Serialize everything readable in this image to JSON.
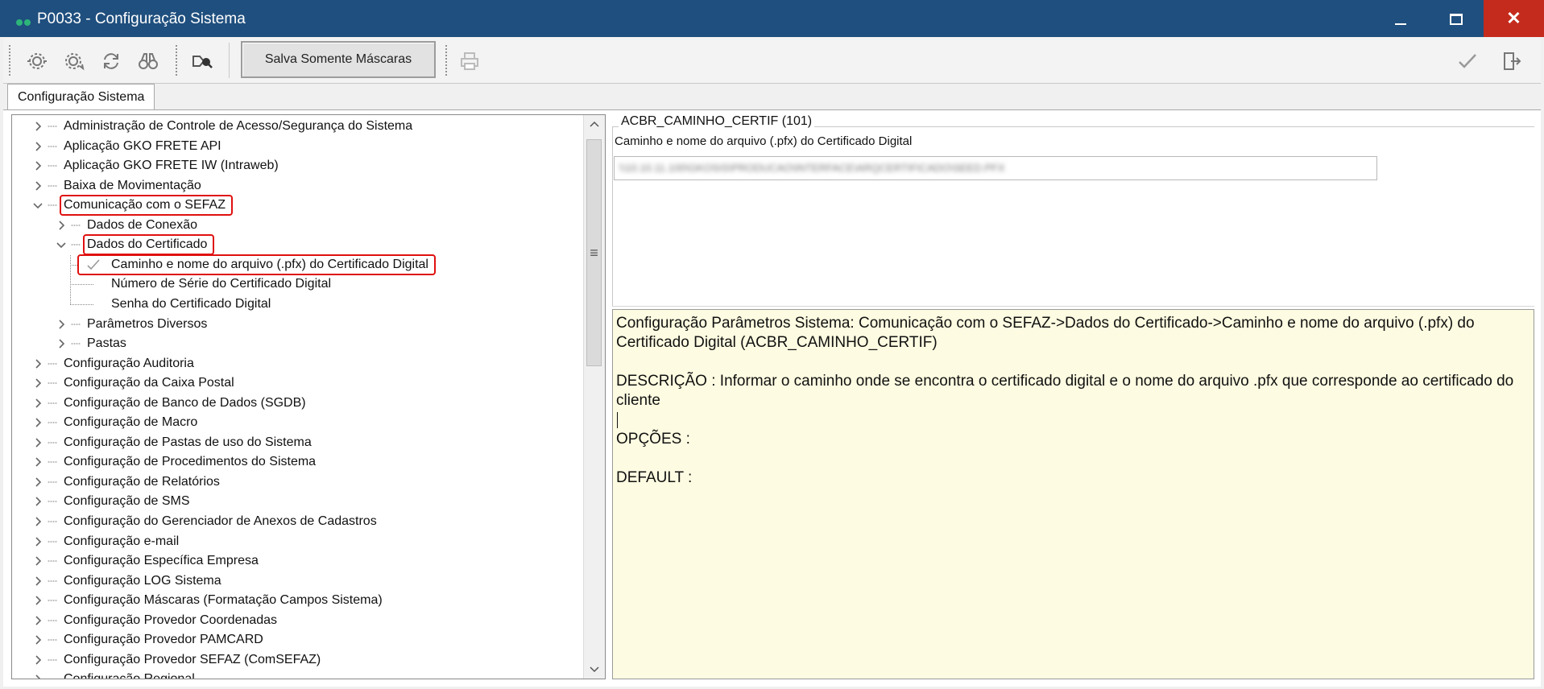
{
  "window": {
    "title": "P0033 - Configuração Sistema",
    "close_glyph": "✕"
  },
  "toolbar": {
    "icons": [
      "gear-settings-icon",
      "gear-refresh-icon",
      "refresh-icon",
      "binoculars-icon",
      "tag-search-icon",
      "printer-icon",
      "check-icon",
      "exit-icon"
    ],
    "save_masks_label": "Salva Somente Máscaras"
  },
  "tabs": [
    {
      "label": "Configuração Sistema"
    }
  ],
  "tree": {
    "nodes": [
      {
        "label": "Administração de Controle de Acesso/Segurança do Sistema",
        "level": 0,
        "state": "collapsed"
      },
      {
        "label": "Aplicação GKO FRETE API",
        "level": 0,
        "state": "collapsed"
      },
      {
        "label": "Aplicação GKO FRETE IW (Intraweb)",
        "level": 0,
        "state": "collapsed"
      },
      {
        "label": "Baixa de Movimentação",
        "level": 0,
        "state": "collapsed"
      },
      {
        "label": "Comunicação com o SEFAZ",
        "level": 0,
        "state": "expanded",
        "highlighted": true
      },
      {
        "label": "Dados de Conexão",
        "level": 1,
        "state": "collapsed"
      },
      {
        "label": "Dados do Certificado",
        "level": 1,
        "state": "expanded",
        "highlighted": true
      },
      {
        "label": "Caminho e nome do arquivo (.pfx) do Certificado Digital",
        "level": 2,
        "state": "leaf",
        "selected": true,
        "checked": true,
        "highlighted": true
      },
      {
        "label": "Número de Série do Certificado Digital",
        "level": 2,
        "state": "leaf"
      },
      {
        "label": "Senha do Certificado Digital",
        "level": 2,
        "state": "leaf"
      },
      {
        "label": "Parâmetros Diversos",
        "level": 1,
        "state": "collapsed"
      },
      {
        "label": "Pastas",
        "level": 1,
        "state": "collapsed"
      },
      {
        "label": "Configuração Auditoria",
        "level": 0,
        "state": "collapsed"
      },
      {
        "label": "Configuração da Caixa Postal",
        "level": 0,
        "state": "collapsed"
      },
      {
        "label": "Configuração de Banco de Dados (SGDB)",
        "level": 0,
        "state": "collapsed"
      },
      {
        "label": "Configuração de Macro",
        "level": 0,
        "state": "collapsed"
      },
      {
        "label": "Configuração de Pastas de uso do Sistema",
        "level": 0,
        "state": "collapsed"
      },
      {
        "label": "Configuração de Procedimentos do Sistema",
        "level": 0,
        "state": "collapsed"
      },
      {
        "label": "Configuração de Relatórios",
        "level": 0,
        "state": "collapsed"
      },
      {
        "label": "Configuração de SMS",
        "level": 0,
        "state": "collapsed"
      },
      {
        "label": "Configuração do Gerenciador de Anexos de Cadastros",
        "level": 0,
        "state": "collapsed"
      },
      {
        "label": "Configuração e-mail",
        "level": 0,
        "state": "collapsed"
      },
      {
        "label": "Configuração Específica Empresa",
        "level": 0,
        "state": "collapsed"
      },
      {
        "label": "Configuração LOG Sistema",
        "level": 0,
        "state": "collapsed"
      },
      {
        "label": "Configuração Máscaras (Formatação Campos Sistema)",
        "level": 0,
        "state": "collapsed"
      },
      {
        "label": "Configuração Provedor Coordenadas",
        "level": 0,
        "state": "collapsed"
      },
      {
        "label": "Configuração Provedor PAMCARD",
        "level": 0,
        "state": "collapsed"
      },
      {
        "label": "Configuração Provedor SEFAZ (ComSEFAZ)",
        "level": 0,
        "state": "collapsed"
      },
      {
        "label": "Configuração Regional",
        "level": 0,
        "state": "collapsed"
      }
    ],
    "scrollbar": {
      "thumb_glyph": "≡"
    }
  },
  "parameter": {
    "code": "ACBR_CAMINHO_CERTIF (101)",
    "description": "Caminho e nome do arquivo (.pfx) do Certificado Digital",
    "value_blurred": "\\\\10.10.11.100\\GKOSIS\\PRODUCAO\\INTERFACE\\ARQCERTIFICADO\\SEED.PFX"
  },
  "help": {
    "lines": [
      "Configuração Parâmetros Sistema: Comunicação com o SEFAZ->Dados do Certificado->Caminho e nome do arquivo (.pfx) do Certificado Digital (ACBR_CAMINHO_CERTIF)",
      "DESCRIÇÃO : Informar o caminho onde se encontra o certificado digital e o nome do arquivo .pfx que corresponde ao certificado do cliente",
      "OPÇÕES :",
      "DEFAULT :"
    ]
  },
  "colors": {
    "titlebar": "#1f4f7e",
    "close": "#c42b1c",
    "highlight_border": "#e01010",
    "help_bg": "#fdfbe1"
  }
}
